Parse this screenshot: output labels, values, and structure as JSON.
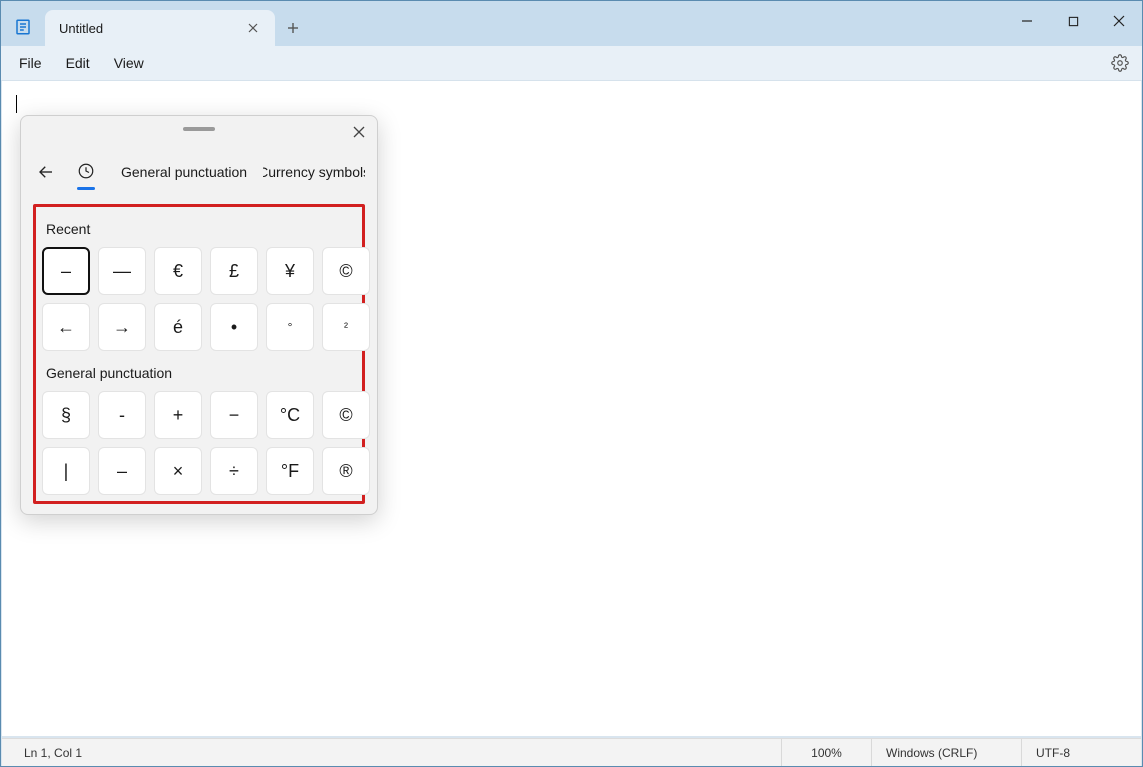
{
  "tab": {
    "title": "Untitled"
  },
  "menu": {
    "file": "File",
    "edit": "Edit",
    "view": "View"
  },
  "panel": {
    "tabs": {
      "general_punctuation": "General punctuation",
      "currency_symbols": "Currency symbols"
    },
    "sections": {
      "recent": {
        "title": "Recent",
        "items": [
          "–",
          "—",
          "€",
          "£",
          "¥",
          "©",
          "←",
          "→",
          "é",
          "•",
          "°",
          "²"
        ]
      },
      "general_punctuation": {
        "title": "General punctuation",
        "items": [
          "§",
          "-",
          "+",
          "−",
          "°C",
          "©",
          "|",
          "–",
          "×",
          "÷",
          "°F",
          "®"
        ]
      }
    }
  },
  "status": {
    "position": "Ln 1, Col 1",
    "zoom": "100%",
    "line_ending": "Windows (CRLF)",
    "encoding": "UTF-8"
  }
}
